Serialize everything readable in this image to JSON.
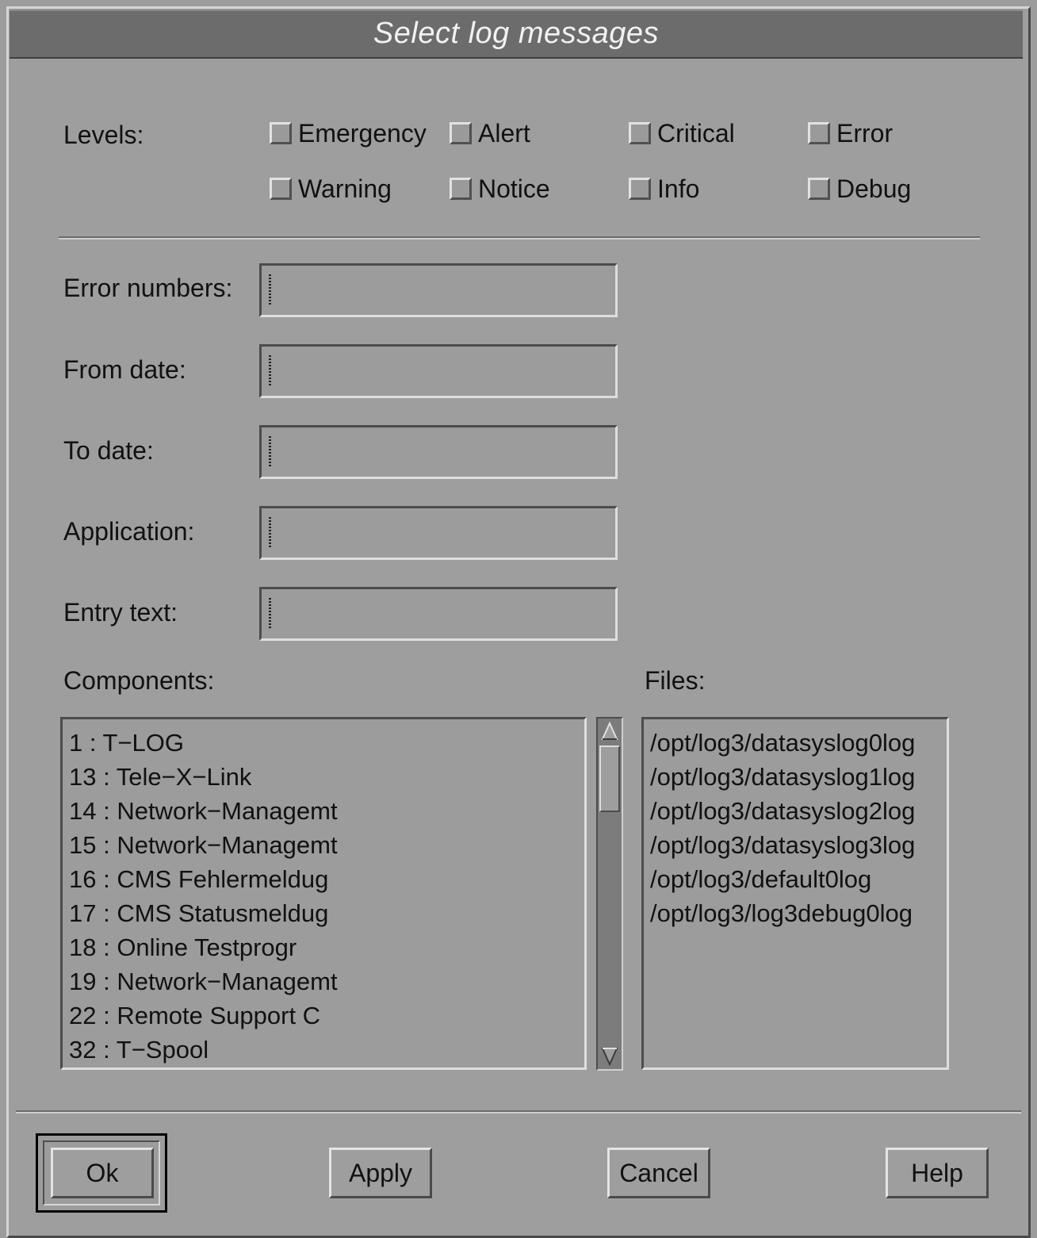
{
  "dialog": {
    "title": "Select log messages"
  },
  "levels": {
    "label": "Levels:",
    "options": [
      {
        "label": "Emergency",
        "checked": false
      },
      {
        "label": "Alert",
        "checked": false
      },
      {
        "label": "Critical",
        "checked": false
      },
      {
        "label": "Error",
        "checked": false
      },
      {
        "label": "Warning",
        "checked": false
      },
      {
        "label": "Notice",
        "checked": false
      },
      {
        "label": "Info",
        "checked": false
      },
      {
        "label": "Debug",
        "checked": false
      }
    ]
  },
  "fields": {
    "error_numbers": {
      "label": "Error numbers:",
      "value": ""
    },
    "from_date": {
      "label": "From date:",
      "value": ""
    },
    "to_date": {
      "label": "To date:",
      "value": ""
    },
    "application": {
      "label": "Application:",
      "value": ""
    },
    "entry_text": {
      "label": "Entry text:",
      "value": ""
    }
  },
  "components": {
    "label": "Components:",
    "items": [
      "1 : T−LOG",
      "13 : Tele−X−Link",
      "14 : Network−Managemt",
      "15 : Network−Managemt",
      "16 : CMS Fehlermeldug",
      "17 : CMS Statusmeldug",
      "18 : Online Testprogr",
      "19 : Network−Managemt",
      "22 : Remote Support C",
      "32 : T−Spool"
    ]
  },
  "files": {
    "label": "Files:",
    "items": [
      "/opt/log3/datasyslog0log",
      "/opt/log3/datasyslog1log",
      "/opt/log3/datasyslog2log",
      "/opt/log3/datasyslog3log",
      "/opt/log3/default0log",
      "/opt/log3/log3debug0log"
    ]
  },
  "buttons": {
    "ok": "Ok",
    "apply": "Apply",
    "cancel": "Cancel",
    "help": "Help"
  },
  "colors": {
    "background": "#9c9c9c",
    "titlebar": "#6c6c6c",
    "title_text": "#f2f2f2"
  }
}
